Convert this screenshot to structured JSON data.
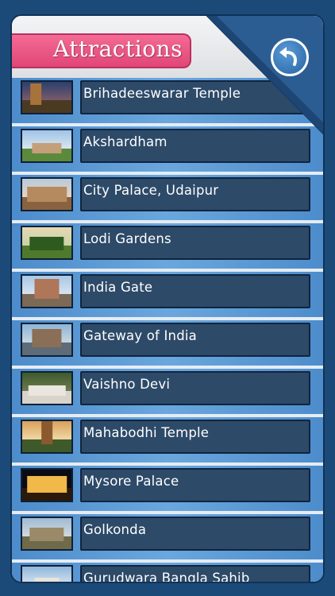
{
  "header": {
    "title": "Attractions",
    "back_icon": "back-arrow-icon",
    "accent_color": "#ee5a86",
    "corner_color": "#2b5d93"
  },
  "list": {
    "items": [
      {
        "label": "Brihadeeswarar Temple"
      },
      {
        "label": "Akshardham"
      },
      {
        "label": "City Palace, Udaipur"
      },
      {
        "label": "Lodi Gardens"
      },
      {
        "label": "India Gate"
      },
      {
        "label": "Gateway of India"
      },
      {
        "label": "Vaishno Devi"
      },
      {
        "label": "Mahabodhi Temple"
      },
      {
        "label": "Mysore Palace"
      },
      {
        "label": "Golkonda"
      },
      {
        "label": "Gurudwara Bangla Sahib"
      }
    ]
  }
}
